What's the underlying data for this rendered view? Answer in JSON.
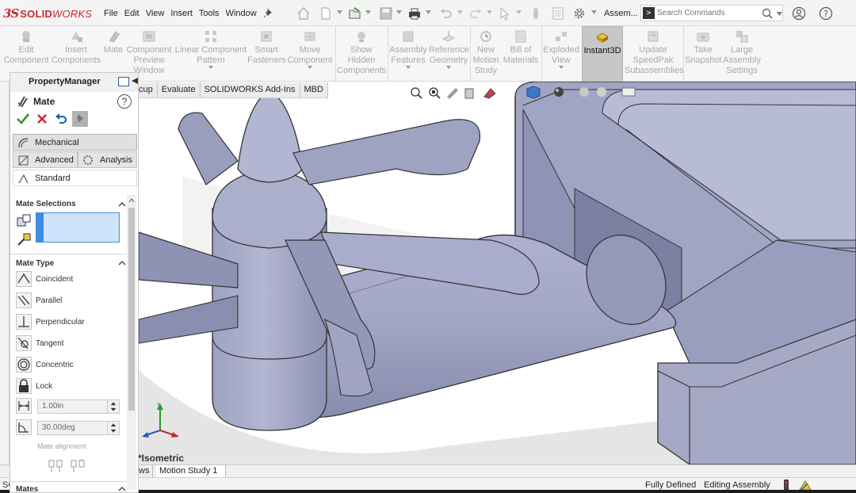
{
  "app": {
    "logo_prefix": "3S",
    "logo_brand_bold": "SOLID",
    "logo_brand_light": "WORKS",
    "doc_title": "Assem..."
  },
  "menu": [
    "File",
    "Edit",
    "View",
    "Insert",
    "Tools",
    "Window"
  ],
  "search": {
    "placeholder": "Search Commands"
  },
  "ribbon": [
    {
      "label": "Edit\nComponent",
      "icon": "edit-component-icon",
      "enabled": false
    },
    {
      "label": "Insert\nComponents",
      "icon": "insert-components-icon",
      "enabled": false
    },
    {
      "label": "Mate",
      "icon": "mate-icon",
      "enabled": false
    },
    {
      "label": "Component\nPreview\nWindow",
      "icon": "component-preview-icon",
      "enabled": false
    },
    {
      "label": "Linear Component\nPattern",
      "icon": "linear-pattern-icon",
      "enabled": false
    },
    {
      "label": "Smart\nFasteners",
      "icon": "smart-fasteners-icon",
      "enabled": false
    },
    {
      "label": "Move\nComponent",
      "icon": "move-component-icon",
      "enabled": false
    },
    {
      "label": "Show\nHidden\nComponents",
      "icon": "show-hidden-icon",
      "enabled": false
    },
    {
      "label": "Assembly\nFeatures",
      "icon": "assembly-features-icon",
      "enabled": false
    },
    {
      "label": "Reference\nGeometry",
      "icon": "reference-geometry-icon",
      "enabled": false
    },
    {
      "label": "New\nMotion\nStudy",
      "icon": "motion-study-icon",
      "enabled": false
    },
    {
      "label": "Bill of\nMaterials",
      "icon": "bom-icon",
      "enabled": false
    },
    {
      "label": "Exploded\nView",
      "icon": "exploded-view-icon",
      "enabled": false
    },
    {
      "label": "Instant3D",
      "icon": "instant3d-icon",
      "enabled": true
    },
    {
      "label": "Update\nSpeedPak\nSubassemblies",
      "icon": "speedpak-icon",
      "enabled": false
    },
    {
      "label": "Take\nSnapshot",
      "icon": "snapshot-icon",
      "enabled": false
    },
    {
      "label": "Large\nAssembly\nSettings",
      "icon": "large-assembly-icon",
      "enabled": false
    }
  ],
  "cm_tabs": [
    "cup",
    "Evaluate",
    "SOLIDWORKS Add-Ins",
    "MBD"
  ],
  "property_manager": {
    "title": "PropertyManager",
    "feature": "Mate",
    "tabs": {
      "mechanical": "Mechanical",
      "advanced": "Advanced",
      "analysis": "Analysis",
      "standard": "Standard"
    },
    "mate_selections_title": "Mate Selections",
    "mate_type_title": "Mate Type",
    "mate_types": [
      "Coincident",
      "Parallel",
      "Perpendicular",
      "Tangent",
      "Concentric",
      "Lock"
    ],
    "distance_value": "1.00in",
    "angle_value": "30.00deg",
    "mate_alignment_label": "Mate alignment",
    "mates_title": "Mates"
  },
  "view": {
    "orientation": "*Isometric"
  },
  "bottom_tabs": [
    "ws",
    "Motion Study 1"
  ],
  "status": {
    "left": "SC",
    "definition": "Fully Defined",
    "mode": "Editing Assembly"
  },
  "colors": {
    "accent": "#d0262d",
    "selection": "#cde4fb",
    "model": "#a3a7c6"
  }
}
